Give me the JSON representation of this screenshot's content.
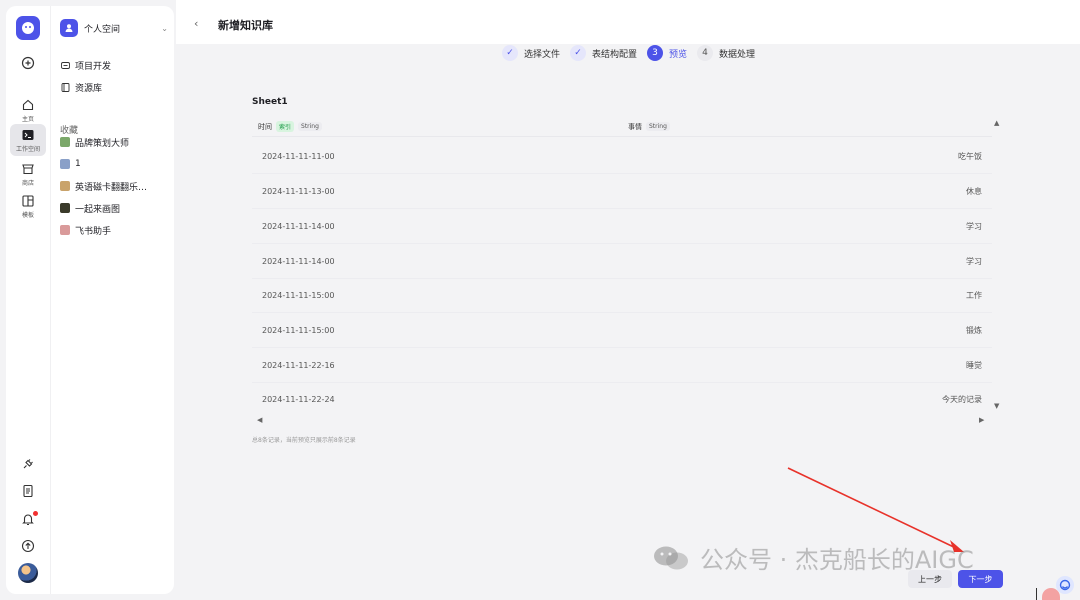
{
  "rail": {
    "items": [
      {
        "label": "主页",
        "icon": "home-icon"
      },
      {
        "label": "工作空间",
        "icon": "terminal-icon"
      },
      {
        "label": "商店",
        "icon": "store-icon"
      },
      {
        "label": "模板",
        "icon": "template-icon"
      }
    ]
  },
  "sidebar": {
    "workspace": "个人空间",
    "items": [
      {
        "label": "项目开发",
        "icon": "project-icon"
      },
      {
        "label": "资源库",
        "icon": "library-icon"
      }
    ],
    "favorites_title": "收藏",
    "favorites": [
      {
        "label": "品牌策划大师",
        "color": "#7ba86a"
      },
      {
        "label": "1",
        "color": "#8aa0c8"
      },
      {
        "label": "英语磁卡翻翻乐…",
        "color": "#c9a36b"
      },
      {
        "label": "一起来画图",
        "color": "#3a3a2a"
      },
      {
        "label": "飞书助手",
        "color": "#d99a9a"
      }
    ]
  },
  "header": {
    "title": "新增知识库"
  },
  "steps": [
    {
      "label": "选择文件",
      "state": "done",
      "mark": "✓"
    },
    {
      "label": "表结构配置",
      "state": "done",
      "mark": "✓"
    },
    {
      "label": "预览",
      "state": "current",
      "mark": "3"
    },
    {
      "label": "数据处理",
      "state": "todo",
      "mark": "4"
    }
  ],
  "sheet": {
    "title": "Sheet1",
    "columns": [
      {
        "name": "时间",
        "index_tag": "索引",
        "type": "String"
      },
      {
        "name": "事情",
        "type": "String"
      }
    ],
    "rows": [
      [
        "2024-11-11-11-00",
        "吃午饭"
      ],
      [
        "2024-11-11-13-00",
        "休息"
      ],
      [
        "2024-11-11-14-00",
        "学习"
      ],
      [
        "2024-11-11-14-00",
        "学习"
      ],
      [
        "2024-11-11-15:00",
        "工作"
      ],
      [
        "2024-11-11-15:00",
        "锻炼"
      ],
      [
        "2024-11-11-22-16",
        "睡觉"
      ],
      [
        "2024-11-11-22-24",
        "今天的记录"
      ]
    ],
    "footnote": "总8条记录，当前预览只展示前8条记录"
  },
  "watermark": "公众号 · 杰克船长的AIGC",
  "actions": {
    "prev": "上一步",
    "next": "下一步"
  },
  "colors": {
    "accent": "#4d53e8",
    "index_tag": "#1a9a45"
  }
}
